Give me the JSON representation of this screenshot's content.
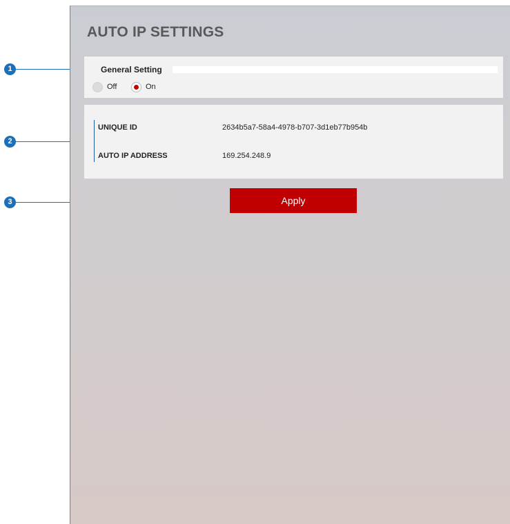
{
  "page": {
    "title": "AUTO IP SETTINGS"
  },
  "general": {
    "label": "General Setting",
    "options": [
      {
        "label": "Off",
        "selected": false
      },
      {
        "label": "On",
        "selected": true
      }
    ]
  },
  "info": {
    "unique_id_label": "UNIQUE ID",
    "unique_id_value": "2634b5a7-58a4-4978-b707-3d1eb77b954b",
    "auto_ip_label": "AUTO IP ADDRESS",
    "auto_ip_value": "169.254.248.9"
  },
  "actions": {
    "apply_label": "Apply"
  },
  "callouts": [
    "1",
    "2",
    "3"
  ],
  "colors": {
    "accent": "#c00000",
    "callout": "#1d6fb8"
  }
}
